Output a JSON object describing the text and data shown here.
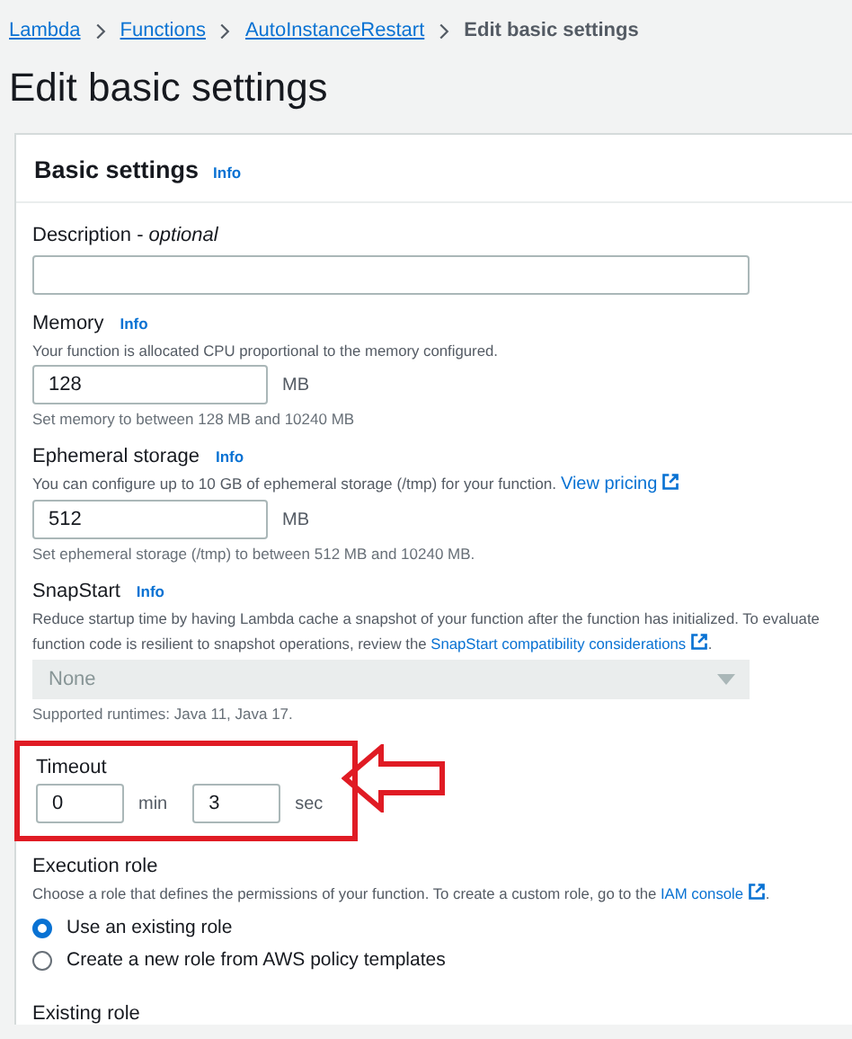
{
  "breadcrumbs": [
    {
      "label": "Lambda",
      "link": true
    },
    {
      "label": "Functions",
      "link": true
    },
    {
      "label": "AutoInstanceRestart",
      "link": true
    },
    {
      "label": "Edit basic settings",
      "link": false
    }
  ],
  "page_title": "Edit basic settings",
  "panel": {
    "title": "Basic settings",
    "info": "Info"
  },
  "fields": [
    {
      "kind": "text",
      "label": "Description - *optional*"
    },
    {
      "kind": "number",
      "label": "Memory",
      "info": "Info",
      "help": [
        [
          {
            "text": "Your function is allocated CPU proportional to the memory configured."
          }
        ]
      ],
      "value": "128",
      "unit": "MB",
      "hint": "Set memory to between 128 MB and 10240 MB"
    },
    {
      "kind": "number",
      "label": "Ephemeral storage",
      "info": "Info",
      "help": [
        [
          {
            "text": "You can configure up to 10 GB of ephemeral storage (/tmp) for your function. "
          },
          {
            "link": "View pricing"
          }
        ]
      ],
      "value": "512",
      "unit": "MB",
      "hint": "Set ephemeral storage (/tmp) to between 512 MB and 10240 MB."
    },
    {
      "kind": "select",
      "label": "SnapStart",
      "info": "Info",
      "help": [
        [
          {
            "text": "Reduce startup time by having Lambda cache a snapshot of your function after the function has initialized. To evaluate"
          }
        ],
        [
          {
            "text": "function code is resilient to snapshot operations, review the "
          },
          {
            "link": "SnapStart compatibility considerations"
          },
          {
            "text": "."
          }
        ]
      ],
      "value": "None",
      "disabled": true,
      "hint": "Supported runtimes: Java 11, Java 17."
    },
    {
      "kind": "timeout",
      "label": "Timeout",
      "highlighted": true,
      "parts": [
        {
          "value": "0",
          "unit": "min"
        },
        {
          "value": "3",
          "unit": "sec"
        }
      ]
    },
    {
      "kind": "radio",
      "label": "Execution role",
      "help": [
        [
          {
            "text": "Choose a role that defines the permissions of your function. To create a custom role, go to the "
          },
          {
            "link": "IAM console"
          },
          {
            "text": "."
          }
        ]
      ],
      "options": [
        {
          "label": "Use an existing role",
          "selected": true
        },
        {
          "label": "Create a new role from AWS policy templates",
          "selected": false
        }
      ]
    },
    {
      "kind": "label",
      "label": "Existing role"
    }
  ]
}
